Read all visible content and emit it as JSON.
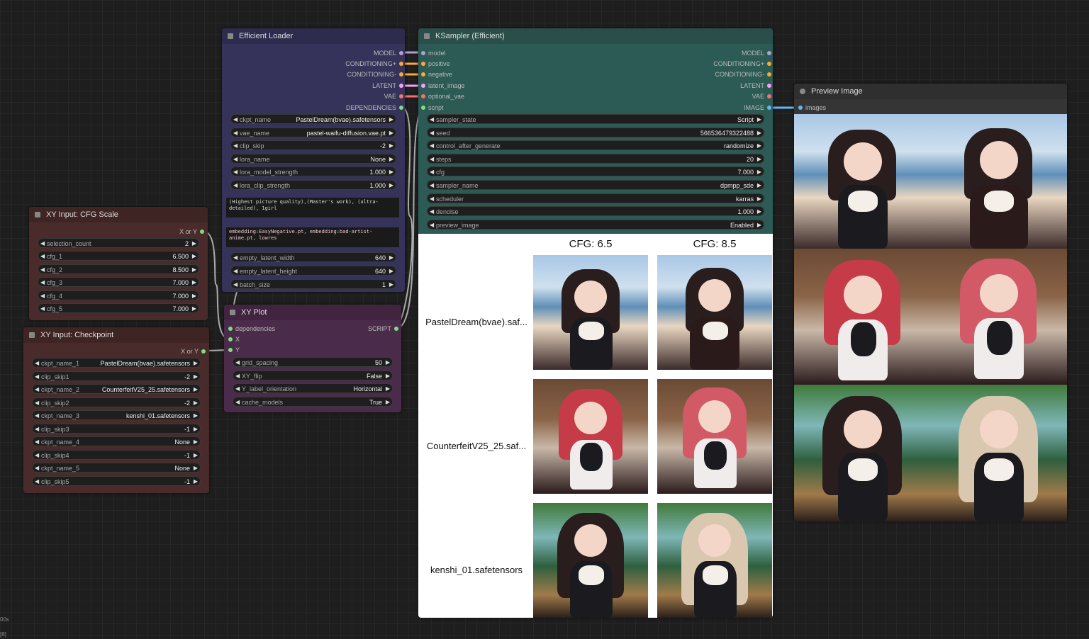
{
  "efficient_loader": {
    "title": "Efficient Loader",
    "outputs": [
      "MODEL",
      "CONDITIONING+",
      "CONDITIONING-",
      "LATENT",
      "VAE",
      "DEPENDENCIES"
    ],
    "widgets": [
      {
        "label": "ckpt_name",
        "value": "PastelDream(bvae).safetensors"
      },
      {
        "label": "vae_name",
        "value": "pastel-waifu-diffusion.vae.pt"
      },
      {
        "label": "clip_skip",
        "value": "-2"
      },
      {
        "label": "lora_name",
        "value": "None"
      },
      {
        "label": "lora_model_strength",
        "value": "1.000"
      },
      {
        "label": "lora_clip_strength",
        "value": "1.000"
      }
    ],
    "positive_prompt": "(Highest picture quality),(Master's work), (ultra-detailed), 1girl",
    "negative_prompt": "embedding:EasyNegative.pt, embedding:bad-artist-anime.pt, lowres",
    "widgets2": [
      {
        "label": "empty_latent_width",
        "value": "640"
      },
      {
        "label": "empty_latent_height",
        "value": "640"
      },
      {
        "label": "batch_size",
        "value": "1"
      }
    ]
  },
  "ksampler": {
    "title": "KSampler (Efficient)",
    "inputs": [
      "model",
      "positive",
      "negative",
      "latent_image",
      "optional_vae",
      "script"
    ],
    "outputs": [
      "MODEL",
      "CONDITIONING+",
      "CONDITIONING-",
      "LATENT",
      "VAE",
      "IMAGE"
    ],
    "widgets": [
      {
        "label": "sampler_state",
        "value": "Script"
      },
      {
        "label": "seed",
        "value": "566536479322488"
      },
      {
        "label": "control_after_generate",
        "value": "randomize"
      },
      {
        "label": "steps",
        "value": "20"
      },
      {
        "label": "cfg",
        "value": "7.000"
      },
      {
        "label": "sampler_name",
        "value": "dpmpp_sde"
      },
      {
        "label": "scheduler",
        "value": "karras"
      },
      {
        "label": "denoise",
        "value": "1.000"
      },
      {
        "label": "preview_image",
        "value": "Enabled"
      }
    ],
    "grid": {
      "col_headers": [
        "CFG: 6.5",
        "CFG: 8.5"
      ],
      "row_headers": [
        "PastelDream(bvae).saf...",
        "CounterfeitV25_25.saf...",
        "kenshi_01.safetensors"
      ]
    }
  },
  "cfg_scale": {
    "title": "XY Input: CFG Scale",
    "output": "X or Y",
    "widgets": [
      {
        "label": "selection_count",
        "value": "2"
      },
      {
        "label": "cfg_1",
        "value": "6.500"
      },
      {
        "label": "cfg_2",
        "value": "8.500"
      },
      {
        "label": "cfg_3",
        "value": "7.000"
      },
      {
        "label": "cfg_4",
        "value": "7.000"
      },
      {
        "label": "cfg_5",
        "value": "7.000"
      }
    ]
  },
  "checkpoint": {
    "title": "XY Input: Checkpoint",
    "output": "X or Y",
    "widgets": [
      {
        "label": "ckpt_name_1",
        "value": "PastelDream(bvae).safetensors"
      },
      {
        "label": "clip_skip1",
        "value": "-2"
      },
      {
        "label": "ckpt_name_2",
        "value": "CounterfeitV25_25.safetensors"
      },
      {
        "label": "clip_skip2",
        "value": "-2"
      },
      {
        "label": "ckpt_name_3",
        "value": "kenshi_01.safetensors"
      },
      {
        "label": "clip_skip3",
        "value": "-1"
      },
      {
        "label": "ckpt_name_4",
        "value": "None"
      },
      {
        "label": "clip_skip4",
        "value": "-1"
      },
      {
        "label": "ckpt_name_5",
        "value": "None"
      },
      {
        "label": "clip_skip5",
        "value": "-1"
      }
    ]
  },
  "xy_plot": {
    "title": "XY Plot",
    "inputs": [
      "dependencies",
      "X",
      "Y"
    ],
    "output": "SCRIPT",
    "widgets": [
      {
        "label": "grid_spacing",
        "value": "50"
      },
      {
        "label": "XY_flip",
        "value": "False"
      },
      {
        "label": "Y_label_orientation",
        "value": "Horizontal"
      },
      {
        "label": "cache_models",
        "value": "True"
      }
    ]
  },
  "preview": {
    "title": "Preview Image",
    "input": "images"
  },
  "corner": {
    "top": "00s",
    "bottom": "[8]"
  },
  "colors": {
    "model": "#b39ddb",
    "conditioning": "#ffa931",
    "latent": "#ff9cf9",
    "vae": "#ff6e6e",
    "green": "#7ee07e",
    "image": "#64b5f6"
  }
}
